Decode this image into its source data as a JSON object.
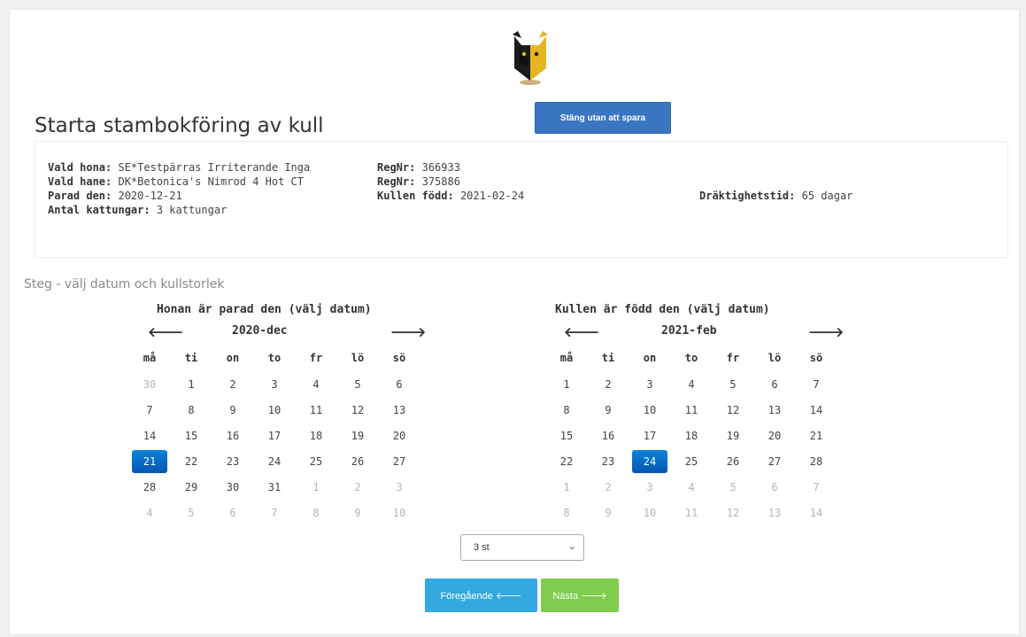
{
  "page": {
    "title": "Starta stambokföring av kull",
    "close_button": "Stäng utan att spara"
  },
  "info": {
    "hona_label": "Vald hona:",
    "hona_value": "SE*Testpärras Irriterande Inga",
    "hane_label": "Vald hane:",
    "hane_value": "DK*Betonica's Nimrod 4 Hot CT",
    "parad_label": "Parad den:",
    "parad_value": "2020-12-21",
    "antal_label": "Antal kattungar:",
    "antal_value": "3 kattungar",
    "regnr1_label": "RegNr:",
    "regnr1_value": "366933",
    "regnr2_label": "RegNr:",
    "regnr2_value": "375886",
    "fodd_label": "Kullen född:",
    "fodd_value": "2021-02-24",
    "drakt_label": "Dräktighetstid:",
    "drakt_value": "65 dagar"
  },
  "step_label": "Steg - välj datum och kullstorlek",
  "weekdays": [
    "må",
    "ti",
    "on",
    "to",
    "fr",
    "lö",
    "sö"
  ],
  "calendars": [
    {
      "title": "Honan är parad den (välj datum)",
      "month": "2020-dec",
      "prev": "🡐",
      "next": "🡒",
      "weeks": [
        [
          {
            "d": "30",
            "m": true
          },
          {
            "d": "1"
          },
          {
            "d": "2"
          },
          {
            "d": "3"
          },
          {
            "d": "4"
          },
          {
            "d": "5"
          },
          {
            "d": "6"
          }
        ],
        [
          {
            "d": "7"
          },
          {
            "d": "8"
          },
          {
            "d": "9"
          },
          {
            "d": "10"
          },
          {
            "d": "11"
          },
          {
            "d": "12"
          },
          {
            "d": "13"
          }
        ],
        [
          {
            "d": "14"
          },
          {
            "d": "15"
          },
          {
            "d": "16"
          },
          {
            "d": "17"
          },
          {
            "d": "18"
          },
          {
            "d": "19"
          },
          {
            "d": "20"
          }
        ],
        [
          {
            "d": "21",
            "s": true
          },
          {
            "d": "22"
          },
          {
            "d": "23"
          },
          {
            "d": "24"
          },
          {
            "d": "25"
          },
          {
            "d": "26"
          },
          {
            "d": "27"
          }
        ],
        [
          {
            "d": "28"
          },
          {
            "d": "29"
          },
          {
            "d": "30"
          },
          {
            "d": "31"
          },
          {
            "d": "1",
            "m": true
          },
          {
            "d": "2",
            "m": true
          },
          {
            "d": "3",
            "m": true
          }
        ],
        [
          {
            "d": "4",
            "m": true
          },
          {
            "d": "5",
            "m": true
          },
          {
            "d": "6",
            "m": true
          },
          {
            "d": "7",
            "m": true
          },
          {
            "d": "8",
            "m": true
          },
          {
            "d": "9",
            "m": true
          },
          {
            "d": "10",
            "m": true
          }
        ]
      ]
    },
    {
      "title": "Kullen är född den (välj datum)",
      "month": "2021-feb",
      "prev": "🡐",
      "next": "🡒",
      "weeks": [
        [
          {
            "d": "1"
          },
          {
            "d": "2"
          },
          {
            "d": "3"
          },
          {
            "d": "4"
          },
          {
            "d": "5"
          },
          {
            "d": "6"
          },
          {
            "d": "7"
          }
        ],
        [
          {
            "d": "8"
          },
          {
            "d": "9"
          },
          {
            "d": "10"
          },
          {
            "d": "11"
          },
          {
            "d": "12"
          },
          {
            "d": "13"
          },
          {
            "d": "14"
          }
        ],
        [
          {
            "d": "15"
          },
          {
            "d": "16"
          },
          {
            "d": "17"
          },
          {
            "d": "18"
          },
          {
            "d": "19"
          },
          {
            "d": "20"
          },
          {
            "d": "21"
          }
        ],
        [
          {
            "d": "22"
          },
          {
            "d": "23"
          },
          {
            "d": "24",
            "s": true
          },
          {
            "d": "25"
          },
          {
            "d": "26"
          },
          {
            "d": "27"
          },
          {
            "d": "28"
          }
        ],
        [
          {
            "d": "1",
            "m": true
          },
          {
            "d": "2",
            "m": true
          },
          {
            "d": "3",
            "m": true
          },
          {
            "d": "4",
            "m": true
          },
          {
            "d": "5",
            "m": true
          },
          {
            "d": "6",
            "m": true
          },
          {
            "d": "7",
            "m": true
          }
        ],
        [
          {
            "d": "8",
            "m": true
          },
          {
            "d": "9",
            "m": true
          },
          {
            "d": "10",
            "m": true
          },
          {
            "d": "11",
            "m": true
          },
          {
            "d": "12",
            "m": true
          },
          {
            "d": "13",
            "m": true
          },
          {
            "d": "14",
            "m": true
          }
        ]
      ]
    }
  ],
  "litter_select": {
    "value": "3 st"
  },
  "buttons": {
    "prev": "Föregående 🡐",
    "next": "Nästa 🡒"
  },
  "colors": {
    "primary": "#3a76c2",
    "selected": "#0a6fcf",
    "info_btn": "#32a9e0",
    "success_btn": "#7fcc4e"
  }
}
